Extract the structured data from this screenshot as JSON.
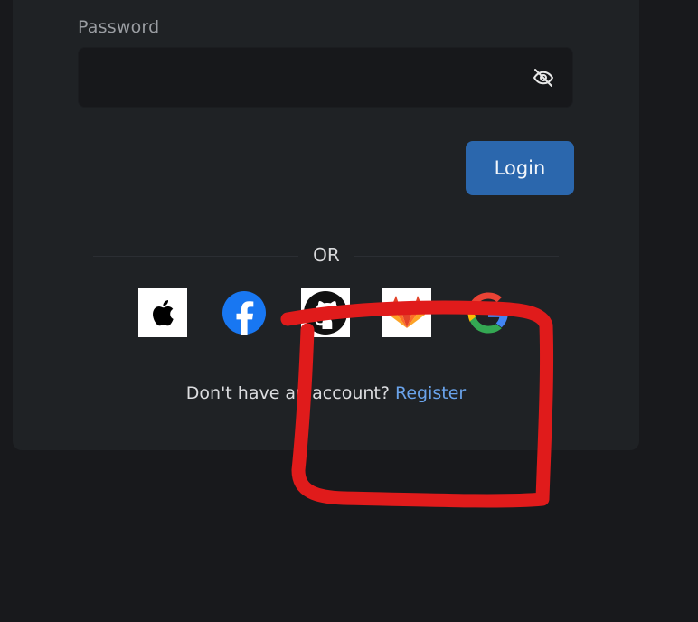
{
  "login_form": {
    "password_label": "Password",
    "password_value": "",
    "login_label": "Login",
    "or_text": "OR",
    "no_account_text": "Don't have an account?",
    "register_label": "Register"
  },
  "social_providers": [
    {
      "name": "Apple",
      "icon": "apple-icon"
    },
    {
      "name": "Facebook",
      "icon": "facebook-icon"
    },
    {
      "name": "GitHub",
      "icon": "github-icon"
    },
    {
      "name": "GitLab",
      "icon": "gitlab-icon"
    },
    {
      "name": "Google",
      "icon": "google-icon"
    }
  ],
  "colors": {
    "page_background": "#18191c",
    "card_background": "#1f2225",
    "input_background": "#17181b",
    "primary_button": "#2b67ad",
    "link": "#6aa3ea",
    "annotation_stroke": "#e01b1b"
  }
}
